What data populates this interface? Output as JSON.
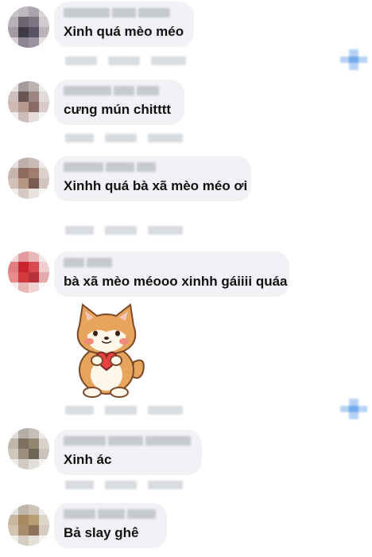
{
  "comments": [
    {
      "text": "Xinh quá mèo méo"
    },
    {
      "text": "cưng mún chitttt"
    },
    {
      "text": "Xinhh quá bà xã mèo méo ơi"
    },
    {
      "text": "bà xã mèo méooo xinhh gáiiii quáa",
      "sticker": "shiba-dog-holding-heart"
    },
    {
      "text": "Xinh ác"
    },
    {
      "text": "Bả slay ghê"
    }
  ],
  "colors": {
    "bubble": "#f0f2f5",
    "text": "#111111",
    "reaction_icon": "#5b9bea"
  },
  "icons": [
    "reaction-icon"
  ]
}
